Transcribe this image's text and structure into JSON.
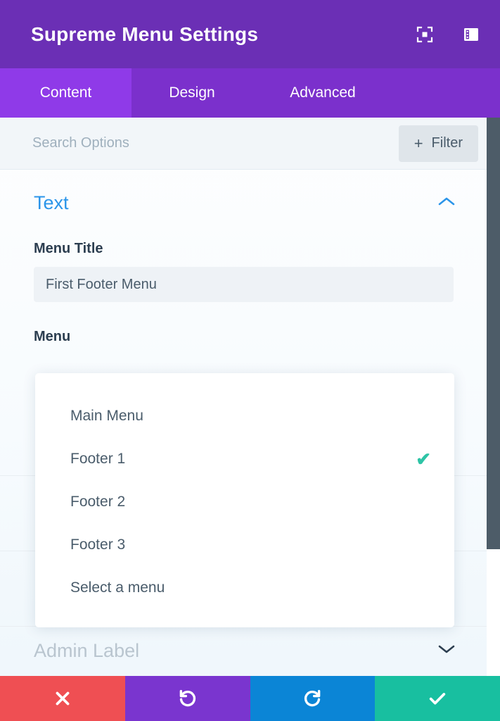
{
  "header": {
    "title": "Supreme Menu Settings",
    "icons": [
      {
        "name": "fullscreen-icon",
        "label": "Fullscreen"
      },
      {
        "name": "layout-panel-icon",
        "label": "Panel Layout"
      }
    ]
  },
  "tabs": [
    {
      "label": "Content",
      "active": true
    },
    {
      "label": "Design",
      "active": false
    },
    {
      "label": "Advanced",
      "active": false
    }
  ],
  "search": {
    "placeholder": "Search Options",
    "value": "",
    "filter_label": "Filter",
    "filter_plus": "+"
  },
  "section": {
    "title": "Text",
    "collapse_glyph": "collapsed-up"
  },
  "fields": {
    "menu_title_label": "Menu Title",
    "menu_title_value": "First Footer Menu",
    "menu_title_placeholder": "Menu Title",
    "menu_label": "Menu"
  },
  "dropdown": {
    "selected": "Footer 1",
    "check_glyph": "✔",
    "options": [
      {
        "label": "Main Menu",
        "checked": false
      },
      {
        "label": "Footer 1",
        "checked": true
      },
      {
        "label": "Footer 2",
        "checked": false
      },
      {
        "label": "Footer 3",
        "checked": false
      },
      {
        "label": "Select a menu",
        "checked": false
      }
    ]
  },
  "next_section": {
    "title": "Admin Label",
    "expand_glyph": "expand-down"
  },
  "bottombar": {
    "buttons": [
      {
        "name": "close-button",
        "label": "Close",
        "glyph": "✖",
        "color": "#ef4f53"
      },
      {
        "name": "undo-button",
        "label": "Undo",
        "glyph": "↺",
        "color": "#7a35cf"
      },
      {
        "name": "redo-button",
        "label": "Redo",
        "glyph": "↻",
        "color": "#0b85d6"
      },
      {
        "name": "save-button",
        "label": "Save",
        "glyph": "✔",
        "color": "#18bfa0"
      }
    ]
  },
  "colors": {
    "header_purple": "#6b2fb5",
    "tabbar_purple": "#7b30cc",
    "tab_active_purple": "#8f3ae8",
    "section_blue": "#2b95e9",
    "check_teal": "#2ec4a6",
    "scrollbar": "#4d5c68"
  }
}
